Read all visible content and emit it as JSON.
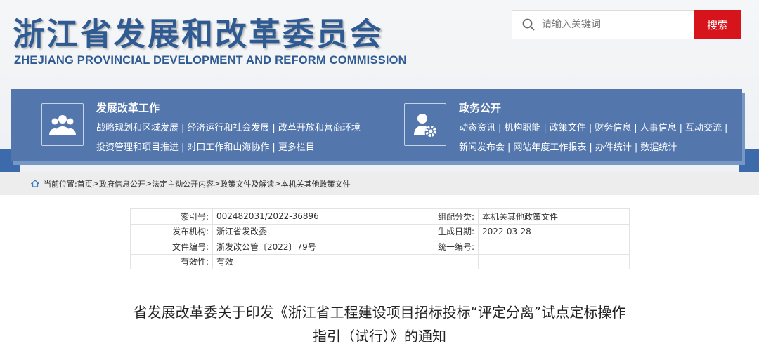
{
  "header": {
    "logo_cn": "浙江省发展和改革委员会",
    "logo_en": "ZHEJIANG PROVINCIAL DEVELOPMENT AND REFORM COMMISSION",
    "search_placeholder": "请输入关键词",
    "search_button": "搜索",
    "brand_color": "#2f5a92",
    "search_button_color": "#d7141c"
  },
  "nav": {
    "panel_color": "#5377ad",
    "sections": [
      {
        "title": "发展改革工作",
        "icon": "people-group-icon",
        "links": [
          "战略规划和区域发展",
          "经济运行和社会发展",
          "改革开放和营商环境",
          "投资管理和项目推进",
          "对口工作和山海协作",
          "更多栏目"
        ]
      },
      {
        "title": "政务公开",
        "icon": "user-gear-icon",
        "links": [
          "动态资讯",
          "机构职能",
          "政策文件",
          "财务信息",
          "人事信息",
          "互动交流",
          "新闻发布会",
          "网站年度工作报表",
          "办件统计",
          "数据统计"
        ]
      }
    ]
  },
  "breadcrumb": {
    "label": "当前位置:",
    "items": [
      "首页",
      "政府信息公开",
      "法定主动公开内容",
      "政策文件及解读",
      "本机关其他政策文件"
    ]
  },
  "meta": {
    "rows": [
      [
        "索引号:",
        "002482031/2022-36896",
        "组配分类:",
        "本机关其他政策文件"
      ],
      [
        "发布机构:",
        "浙江省发改委",
        "生成日期:",
        "2022-03-28"
      ],
      [
        "文件编号:",
        "浙发改公管〔2022〕79号",
        "统一编号:",
        ""
      ],
      [
        "有效性:",
        "有效",
        "",
        ""
      ]
    ]
  },
  "document": {
    "title_line1": "省发展改革委关于印发《浙江省工程建设项目招标投标“评定分离”试点定标操作",
    "title_line2": "指引（试行）》的通知"
  }
}
